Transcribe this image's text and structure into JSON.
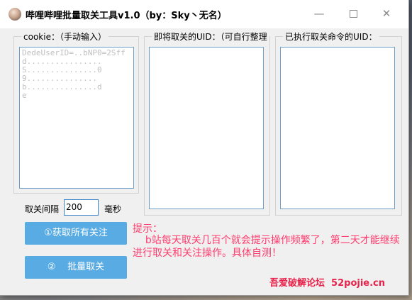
{
  "window": {
    "title": "哔哩哔哩批量取关工具v1.0（by：Sky丶无名）",
    "minimize": "—",
    "maximize": "",
    "close": "✕"
  },
  "cookie_group": {
    "legend": "cookie：（手动输入）",
    "text": "DedeUserID=..bNP0=2Sff\nd................\nS...............0\n9...............\nb...............d\ne"
  },
  "pending_group": {
    "legend": "即将取关的UID：（可自行整理"
  },
  "executed_group": {
    "legend": "已执行取关命令的UID："
  },
  "interval": {
    "label": "取关间隔",
    "value": "200",
    "unit": "毫秒"
  },
  "buttons": {
    "fetch_label": "①获取所有关注",
    "unfollow_label": "②    批量取关"
  },
  "tip": {
    "title": "提示：",
    "body": "    b站每天取关几百个就会提示操作频繁了，第二天才能继续进行取关和关注操作。具体自测！"
  },
  "footer": {
    "text": "吾爱破解论坛  52pojie.cn"
  },
  "colors": {
    "button_bg": "#59ace3",
    "tip_text": "#ff3c6e",
    "footer_text": "#e8224a",
    "textarea_border": "#6e9fc8"
  }
}
